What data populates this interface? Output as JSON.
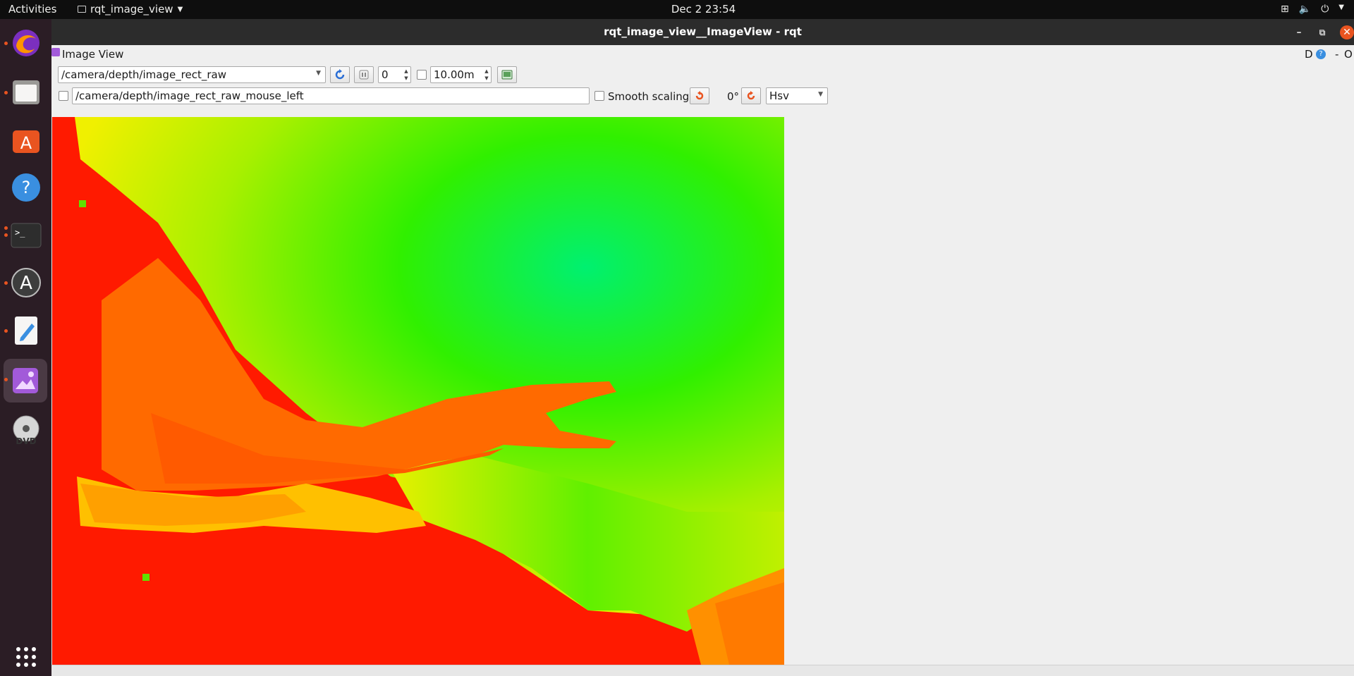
{
  "topbar": {
    "activities": "Activities",
    "app_name": "rqt_image_view",
    "clock": "Dec 2  23:54"
  },
  "window": {
    "title": "rqt_image_view__ImageView - rqt"
  },
  "plugin": {
    "title": "Image View",
    "right_label_d": "D",
    "right_label_o": "O"
  },
  "toolbar": {
    "topic": "/camera/depth/image_rect_raw",
    "min_value": "0",
    "max_value": "10.00m",
    "mouse_topic": "/camera/depth/image_rect_raw_mouse_left",
    "smooth_scaling_label": "Smooth scaling",
    "rotation": "0°",
    "colormap": "Hsv"
  },
  "colors": {
    "accent": "#e95420",
    "topbar": "#0e0e0e",
    "dock": "#2b1d25",
    "titlebar": "#2c2c2c"
  }
}
